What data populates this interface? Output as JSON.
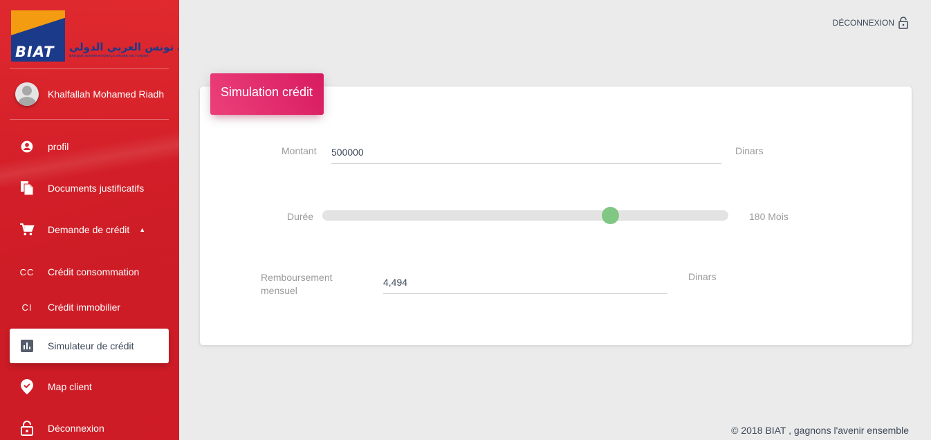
{
  "brand": {
    "logo_text": "BIAT",
    "logo_arabic": "بنك تونس العربي الدولي",
    "logo_sub": "BANQUE INTERNATIONALE ARABE DE TUNISIE",
    "primary_color": "#e22a30",
    "accent_color": "#e91e63"
  },
  "user": {
    "name": "Khalfallah Mohamed Riadh"
  },
  "sidebar": {
    "items": [
      {
        "label": "profil",
        "icon": "account-circle-icon"
      },
      {
        "label": "Documents justificatifs",
        "icon": "documents-icon"
      },
      {
        "label": "Demande de crédit",
        "icon": "cart-icon",
        "expanded": true
      },
      {
        "label": "Crédit consommation",
        "abbr": "CC"
      },
      {
        "label": "Crédit immobilier",
        "abbr": "CI"
      },
      {
        "label": "Simulateur de crédit",
        "icon": "bar-chart-icon",
        "active": true
      },
      {
        "label": "Map client",
        "icon": "location-check-icon"
      },
      {
        "label": "Déconnexion",
        "icon": "lock-open-icon"
      }
    ]
  },
  "header": {
    "logout_label": "DÉCONNEXION"
  },
  "card": {
    "title": "Simulation crédit",
    "montant": {
      "label": "Montant",
      "value": "500000",
      "unit": "Dinars"
    },
    "duree": {
      "label": "Durée",
      "value_label": "180 Mois",
      "fraction": 0.71,
      "thumb_color": "#81c784"
    },
    "remboursement": {
      "label_line1": "Remboursement",
      "label_line2": "mensuel",
      "value": "4,494",
      "unit": "Dinars"
    }
  },
  "footer": {
    "text": "© 2018 BIAT , gagnons l'avenir ensemble"
  }
}
